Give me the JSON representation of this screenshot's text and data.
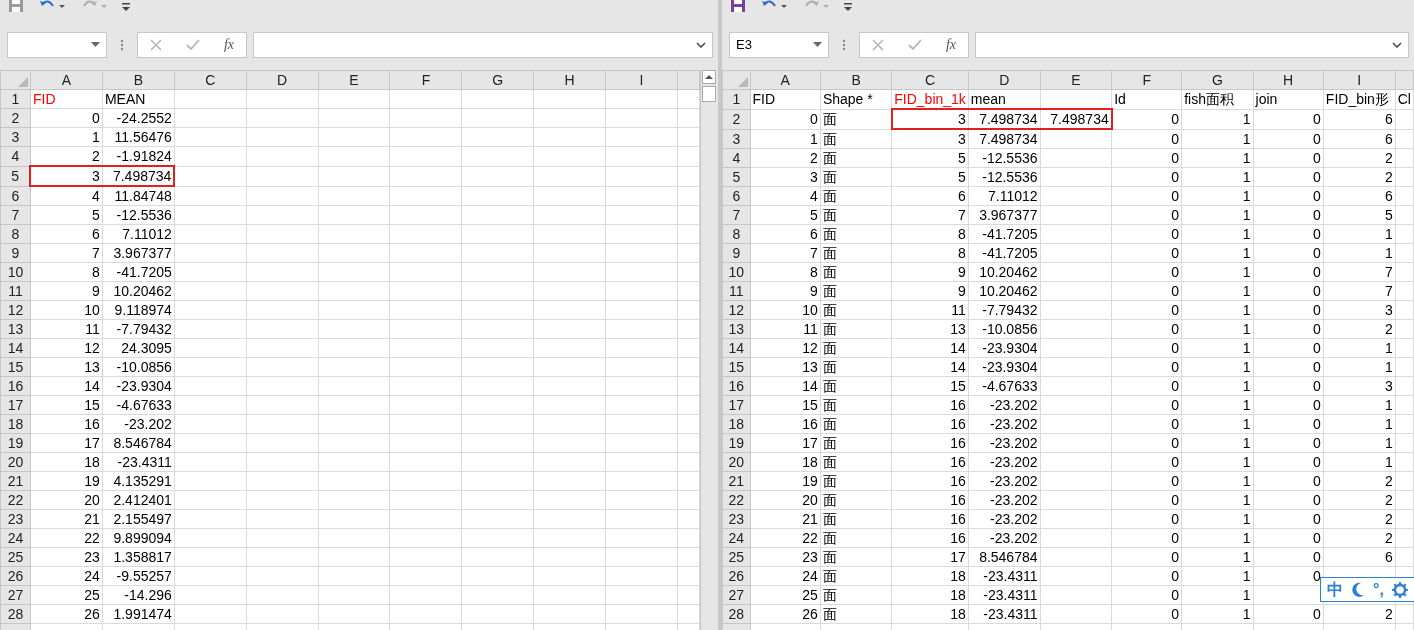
{
  "windows": [
    {
      "save_active": false,
      "fx_label": "fx",
      "columns": [
        "A",
        "B",
        "C",
        "D",
        "E",
        "F",
        "G",
        "H",
        "I"
      ],
      "scrollbar": true,
      "rows": [
        {
          "number": "1",
          "cells": [
            {
              "text": "FID",
              "color": "#ff0000"
            },
            "MEAN"
          ]
        },
        {
          "number": "2",
          "cells": [
            "0",
            "-24.2552"
          ]
        },
        {
          "number": "3",
          "cells": [
            "1",
            "11.56476"
          ]
        },
        {
          "number": "4",
          "cells": [
            "2",
            "-1.91824"
          ]
        },
        {
          "number": "5",
          "cells": [
            {
              "text": "3",
              "boxed": true
            },
            {
              "text": "7.498734",
              "boxed": true
            }
          ]
        },
        {
          "number": "6",
          "cells": [
            "4",
            "11.84748"
          ]
        },
        {
          "number": "7",
          "cells": [
            "5",
            "-12.5536"
          ]
        },
        {
          "number": "8",
          "cells": [
            "6",
            "7.11012"
          ]
        },
        {
          "number": "9",
          "cells": [
            "7",
            "3.967377"
          ]
        },
        {
          "number": "10",
          "cells": [
            "8",
            "-41.7205"
          ]
        },
        {
          "number": "11",
          "cells": [
            "9",
            "10.20462"
          ]
        },
        {
          "number": "12",
          "cells": [
            "10",
            "9.118974"
          ]
        },
        {
          "number": "13",
          "cells": [
            "11",
            "-7.79432"
          ]
        },
        {
          "number": "14",
          "cells": [
            "12",
            "24.3095"
          ]
        },
        {
          "number": "15",
          "cells": [
            "13",
            "-10.0856"
          ]
        },
        {
          "number": "16",
          "cells": [
            "14",
            "-23.9304"
          ]
        },
        {
          "number": "17",
          "cells": [
            "15",
            "-4.67633"
          ]
        },
        {
          "number": "18",
          "cells": [
            "16",
            "-23.202"
          ]
        },
        {
          "number": "19",
          "cells": [
            "17",
            "8.546784"
          ]
        },
        {
          "number": "20",
          "cells": [
            "18",
            "-23.4311"
          ]
        },
        {
          "number": "21",
          "cells": [
            "19",
            "4.135291"
          ]
        },
        {
          "number": "22",
          "cells": [
            "20",
            "2.412401"
          ]
        },
        {
          "number": "23",
          "cells": [
            "21",
            "2.155497"
          ]
        },
        {
          "number": "24",
          "cells": [
            "22",
            "9.899094"
          ]
        },
        {
          "number": "25",
          "cells": [
            "23",
            "1.358817"
          ]
        },
        {
          "number": "26",
          "cells": [
            "24",
            "-9.55257"
          ]
        },
        {
          "number": "27",
          "cells": [
            "25",
            "-14.296"
          ]
        },
        {
          "number": "28",
          "cells": [
            "26",
            "1.991474"
          ]
        }
      ]
    },
    {
      "save_active": true,
      "name_box": "E3",
      "fx_label": "fx",
      "columns": [
        "A",
        "B",
        "C",
        "D",
        "E",
        "F",
        "G",
        "H",
        "I"
      ],
      "rows": [
        {
          "number": "1",
          "cells": [
            "FID",
            "Shape *",
            {
              "text": "FID_bin_1k",
              "color": "#ff0000"
            },
            "mean",
            null,
            "Id",
            "fish面积",
            "join",
            "FID_bin形",
            "Cl"
          ]
        },
        {
          "number": "2",
          "cells": [
            "0",
            "面",
            {
              "text": "3",
              "boxed": true
            },
            {
              "text": "7.498734",
              "boxed": true
            },
            {
              "text": "7.498734",
              "boxed": true
            },
            "0",
            "1",
            "0",
            "6"
          ]
        },
        {
          "number": "3",
          "cells": [
            "1",
            "面",
            "3",
            "7.498734",
            null,
            "0",
            "1",
            "0",
            "6"
          ]
        },
        {
          "number": "4",
          "cells": [
            "2",
            "面",
            "5",
            "-12.5536",
            null,
            "0",
            "1",
            "0",
            "2"
          ]
        },
        {
          "number": "5",
          "cells": [
            "3",
            "面",
            "5",
            "-12.5536",
            null,
            "0",
            "1",
            "0",
            "2"
          ]
        },
        {
          "number": "6",
          "cells": [
            "4",
            "面",
            "6",
            "7.11012",
            null,
            "0",
            "1",
            "0",
            "6"
          ]
        },
        {
          "number": "7",
          "cells": [
            "5",
            "面",
            "7",
            "3.967377",
            null,
            "0",
            "1",
            "0",
            "5"
          ]
        },
        {
          "number": "8",
          "cells": [
            "6",
            "面",
            "8",
            "-41.7205",
            null,
            "0",
            "1",
            "0",
            "1"
          ]
        },
        {
          "number": "9",
          "cells": [
            "7",
            "面",
            "8",
            "-41.7205",
            null,
            "0",
            "1",
            "0",
            "1"
          ]
        },
        {
          "number": "10",
          "cells": [
            "8",
            "面",
            "9",
            "10.20462",
            null,
            "0",
            "1",
            "0",
            "7"
          ]
        },
        {
          "number": "11",
          "cells": [
            "9",
            "面",
            "9",
            "10.20462",
            null,
            "0",
            "1",
            "0",
            "7"
          ]
        },
        {
          "number": "12",
          "cells": [
            "10",
            "面",
            "11",
            "-7.79432",
            null,
            "0",
            "1",
            "0",
            "3"
          ]
        },
        {
          "number": "13",
          "cells": [
            "11",
            "面",
            "13",
            "-10.0856",
            null,
            "0",
            "1",
            "0",
            "2"
          ]
        },
        {
          "number": "14",
          "cells": [
            "12",
            "面",
            "14",
            "-23.9304",
            null,
            "0",
            "1",
            "0",
            "1"
          ]
        },
        {
          "number": "15",
          "cells": [
            "13",
            "面",
            "14",
            "-23.9304",
            null,
            "0",
            "1",
            "0",
            "1"
          ]
        },
        {
          "number": "16",
          "cells": [
            "14",
            "面",
            "15",
            "-4.67633",
            null,
            "0",
            "1",
            "0",
            "3"
          ]
        },
        {
          "number": "17",
          "cells": [
            "15",
            "面",
            "16",
            "-23.202",
            null,
            "0",
            "1",
            "0",
            "1"
          ]
        },
        {
          "number": "18",
          "cells": [
            "16",
            "面",
            "16",
            "-23.202",
            null,
            "0",
            "1",
            "0",
            "1"
          ]
        },
        {
          "number": "19",
          "cells": [
            "17",
            "面",
            "16",
            "-23.202",
            null,
            "0",
            "1",
            "0",
            "1"
          ]
        },
        {
          "number": "20",
          "cells": [
            "18",
            "面",
            "16",
            "-23.202",
            null,
            "0",
            "1",
            "0",
            "1"
          ]
        },
        {
          "number": "21",
          "cells": [
            "19",
            "面",
            "16",
            "-23.202",
            null,
            "0",
            "1",
            "0",
            "2"
          ]
        },
        {
          "number": "22",
          "cells": [
            "20",
            "面",
            "16",
            "-23.202",
            null,
            "0",
            "1",
            "0",
            "2"
          ]
        },
        {
          "number": "23",
          "cells": [
            "21",
            "面",
            "16",
            "-23.202",
            null,
            "0",
            "1",
            "0",
            "2"
          ]
        },
        {
          "number": "24",
          "cells": [
            "22",
            "面",
            "16",
            "-23.202",
            null,
            "0",
            "1",
            "0",
            "2"
          ]
        },
        {
          "number": "25",
          "cells": [
            "23",
            "面",
            "17",
            "8.546784",
            null,
            "0",
            "1",
            "0",
            "6"
          ]
        },
        {
          "number": "26",
          "cells": [
            "24",
            "面",
            "18",
            "-23.4311",
            null,
            "0",
            "1",
            "0"
          ]
        },
        {
          "number": "27",
          "cells": [
            "25",
            "面",
            "18",
            "-23.4311",
            null,
            "0",
            "1"
          ]
        },
        {
          "number": "28",
          "cells": [
            "26",
            "面",
            "18",
            "-23.4311",
            null,
            "0",
            "1",
            "0",
            "2"
          ]
        }
      ]
    }
  ],
  "ime_toolbar": {
    "mode": "中",
    "punctuation": "°,"
  }
}
